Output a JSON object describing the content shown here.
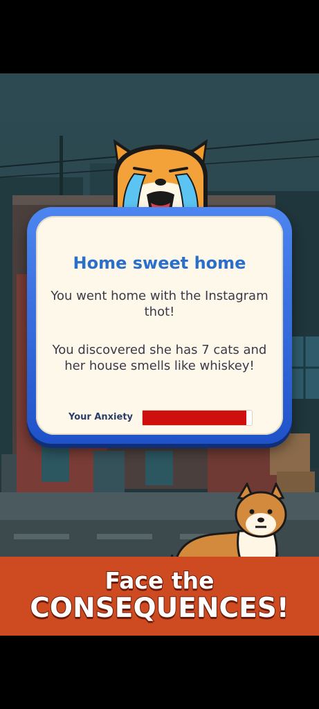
{
  "popup": {
    "title": "Home sweet home",
    "line1": "You went home with the Instagram thot!",
    "line2": "You discovered she has 7 cats and her house smells like whiskey!",
    "anxiety_label": "Your Anxiety",
    "anxiety_level": 0.95
  },
  "banner": {
    "line1": "Face the",
    "line2": "CONSEQUENCES!"
  },
  "colors": {
    "popup_border": "#2f6ae0",
    "title": "#2a6fc9",
    "anxiety_fill": "#cf0e0e",
    "banner": "#ce4b22"
  },
  "icons": [
    "crying-shiba-icon",
    "lying-shiba-icon"
  ]
}
